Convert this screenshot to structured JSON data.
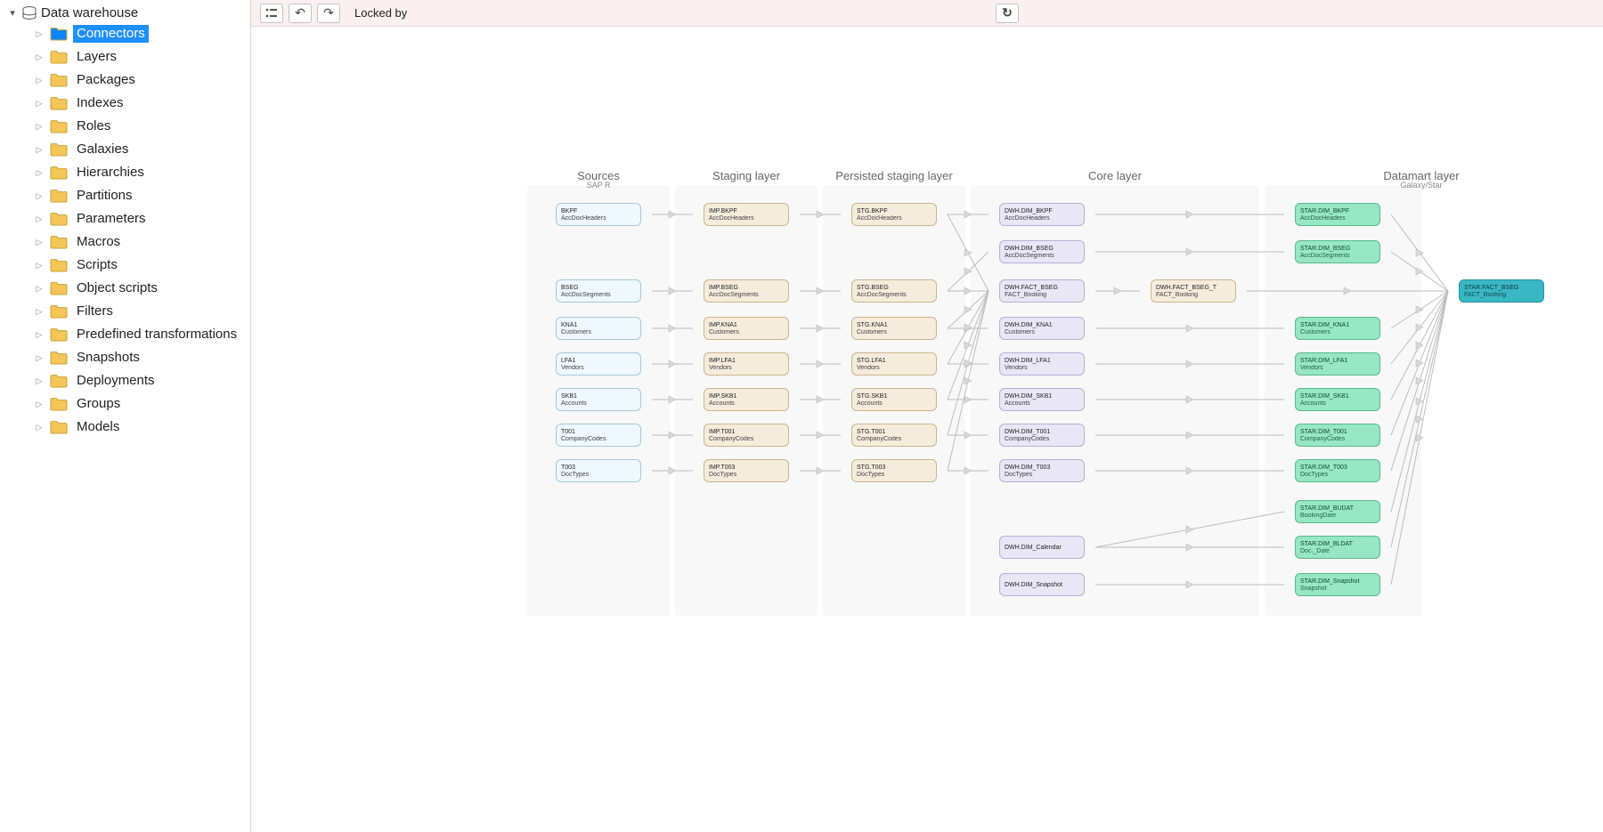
{
  "tree": {
    "root": "Data warehouse",
    "items": [
      "Connectors",
      "Layers",
      "Packages",
      "Indexes",
      "Roles",
      "Galaxies",
      "Hierarchies",
      "Partitions",
      "Parameters",
      "Macros",
      "Scripts",
      "Object scripts",
      "Filters",
      "Predefined transformations",
      "Snapshots",
      "Deployments",
      "Groups",
      "Models"
    ],
    "selected": "Connectors"
  },
  "toolbar": {
    "locked_label": "Locked by"
  },
  "columns": [
    {
      "id": "sources",
      "title": "Sources",
      "sub": "SAP R"
    },
    {
      "id": "staging",
      "title": "Staging layer"
    },
    {
      "id": "persisted",
      "title": "Persisted staging layer"
    },
    {
      "id": "core",
      "title": "Core layer"
    },
    {
      "id": "datamart",
      "title": "Datamart layer",
      "sub": "Galaxy/Star"
    }
  ],
  "nodes": {
    "sources": [
      {
        "line1": "BKPF",
        "line2": "AccDocHeaders"
      },
      {
        "line1": "BSEG",
        "line2": "AccDocSegments"
      },
      {
        "line1": "KNA1",
        "line2": "Customers"
      },
      {
        "line1": "LFA1",
        "line2": "Vendors"
      },
      {
        "line1": "SKB1",
        "line2": "Accounts"
      },
      {
        "line1": "T001",
        "line2": "CompanyCodes"
      },
      {
        "line1": "T003",
        "line2": "DocTypes"
      }
    ],
    "staging": [
      {
        "line1": "IMP.BKPF",
        "line2": "AccDocHeaders"
      },
      {
        "line1": "IMP.BSEG",
        "line2": "AccDocSegments"
      },
      {
        "line1": "IMP.KNA1",
        "line2": "Customers"
      },
      {
        "line1": "IMP.LFA1",
        "line2": "Vendors"
      },
      {
        "line1": "IMP.SKB1",
        "line2": "Accounts"
      },
      {
        "line1": "IMP.T001",
        "line2": "CompanyCodes"
      },
      {
        "line1": "IMP.T003",
        "line2": "DocTypes"
      }
    ],
    "persisted": [
      {
        "line1": "STG.BKPF",
        "line2": "AccDocHeaders"
      },
      {
        "line1": "STG.BSEG",
        "line2": "AccDocSegments"
      },
      {
        "line1": "STG.KNA1",
        "line2": "Customers"
      },
      {
        "line1": "STG.LFA1",
        "line2": "Vendors"
      },
      {
        "line1": "STG.SKB1",
        "line2": "Accounts"
      },
      {
        "line1": "STG.T001",
        "line2": "CompanyCodes"
      },
      {
        "line1": "STG.T003",
        "line2": "DocTypes"
      }
    ],
    "core": [
      {
        "line1": "DWH.DIM_BKPF",
        "line2": "AccDocHeaders"
      },
      {
        "line1": "DWH.DIM_BSEG",
        "line2": "AccDocSegments"
      },
      {
        "line1": "DWH.FACT_BSEG",
        "line2": "FACT_Booking"
      },
      {
        "line1": "DWH.DIM_KNA1",
        "line2": "Customers"
      },
      {
        "line1": "DWH.DIM_LFA1",
        "line2": "Vendors"
      },
      {
        "line1": "DWH.DIM_SKB1",
        "line2": "Accounts"
      },
      {
        "line1": "DWH.DIM_T001",
        "line2": "CompanyCodes"
      },
      {
        "line1": "DWH.DIM_T003",
        "line2": "DocTypes"
      },
      {
        "line1": "DWH.DIM_Calendar",
        "line2": ""
      },
      {
        "line1": "DWH.DIM_Snapshot",
        "line2": ""
      }
    ],
    "core_extra": {
      "line1": "DWH.FACT_BSEG_T",
      "line2": "FACT_Booking"
    },
    "datamart": [
      {
        "line1": "STAR.DIM_BKPF",
        "line2": "AccDocHeaders"
      },
      {
        "line1": "STAR.DIM_BSEG",
        "line2": "AccDocSegments"
      },
      {
        "line1": "STAR.DIM_KNA1",
        "line2": "Customers"
      },
      {
        "line1": "STAR.DIM_LFA1",
        "line2": "Vendors"
      },
      {
        "line1": "STAR.DIM_SKB1",
        "line2": "Accounts"
      },
      {
        "line1": "STAR.DIM_T001",
        "line2": "CompanyCodes"
      },
      {
        "line1": "STAR.DIM_T003",
        "line2": "DocTypes"
      },
      {
        "line1": "STAR.DIM_BUDAT",
        "line2": "BookingDate"
      },
      {
        "line1": "STAR.DIM_BLDAT",
        "line2": "Doc._Date"
      },
      {
        "line1": "STAR.DIM_Snapshot",
        "line2": "Snapshot"
      }
    ],
    "datamart_fact": {
      "line1": "STAR.FACT_BSEG",
      "line2": "FACT_Booking"
    }
  }
}
